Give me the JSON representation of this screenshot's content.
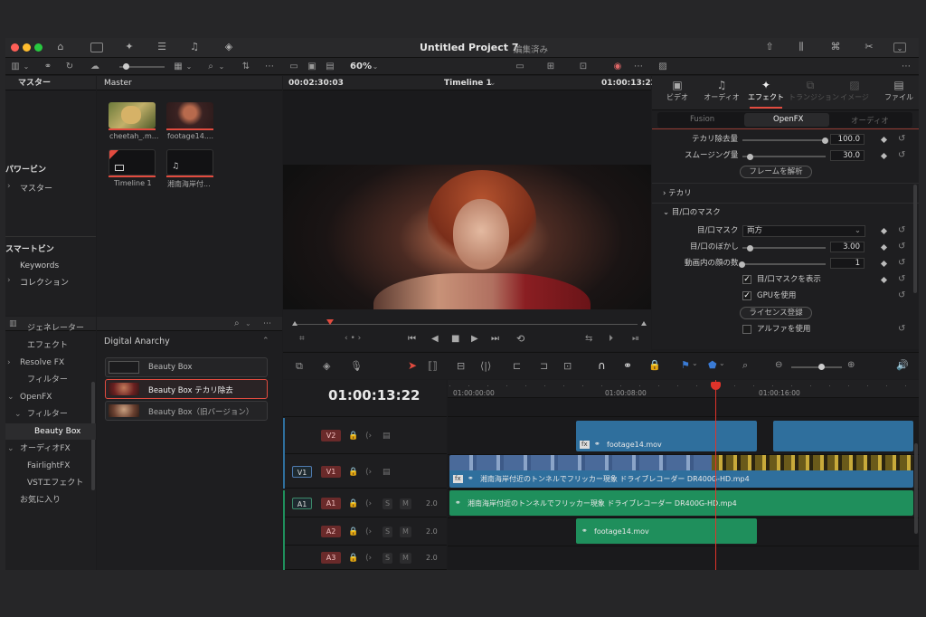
{
  "colors": {
    "accent": "#e24b3f",
    "video_clip": "#2f6f9d",
    "audio_clip": "#1f8f5c",
    "playhead": "#e0332a",
    "window_bg": "#1c1c1e"
  },
  "title": {
    "project": "Untitled Project 7",
    "status": "編集済み"
  },
  "toolbar": {
    "zoom": "60%"
  },
  "media_pool": {
    "sidebar_title": "マスター",
    "bin_title": "Master",
    "power_bins_title": "パワービン",
    "power_bins_items": [
      "マスター"
    ],
    "smart_bins_title": "スマートビン",
    "smart_bins_items": [
      "Keywords",
      "コレクション"
    ],
    "clips": [
      {
        "name": "cheetah_.m...",
        "icon": "video-thumb"
      },
      {
        "name": "footage14....",
        "icon": "video-thumb"
      },
      {
        "name": "Timeline 1",
        "icon": "timeline-icon"
      },
      {
        "name": "湘南海岸付...",
        "icon": "music-icon"
      }
    ]
  },
  "effects_tree": [
    {
      "label": "ジェネレーター",
      "indent": 1,
      "arrow": ""
    },
    {
      "label": "エフェクト",
      "indent": 1,
      "arrow": ""
    },
    {
      "label": "Resolve FX",
      "indent": 0,
      "arrow": "›"
    },
    {
      "label": "フィルター",
      "indent": 1,
      "arrow": ""
    },
    {
      "label": "OpenFX",
      "indent": 0,
      "arrow": "⌄"
    },
    {
      "label": "フィルター",
      "indent": 1,
      "arrow": "⌄"
    },
    {
      "label": "Beauty Box",
      "indent": 2,
      "arrow": ""
    },
    {
      "label": "オーディオFX",
      "indent": 0,
      "arrow": "⌄"
    },
    {
      "label": "FairlightFX",
      "indent": 1,
      "arrow": ""
    },
    {
      "label": "VSTエフェクト",
      "indent": 1,
      "arrow": ""
    },
    {
      "label": "お気に入り",
      "indent": 0,
      "arrow": ""
    }
  ],
  "effects_list": {
    "group": "Digital Anarchy",
    "items": [
      "Beauty Box",
      "Beauty Box テカリ除去",
      "Beauty Box（旧バージョン）"
    ]
  },
  "viewer": {
    "duration": "00:02:30:03",
    "timeline_name": "Timeline 1",
    "timecode": "01:00:13:22"
  },
  "inspector": {
    "top_tabs": [
      "ビデオ",
      "オーディオ",
      "エフェクト",
      "トランジション",
      "イメージ",
      "ファイル"
    ],
    "sub_tabs": [
      "Fusion",
      "OpenFX",
      "オーディオ"
    ],
    "rows": {
      "shine_removal_label": "テカリ除去量",
      "shine_removal_value": "100.0",
      "shine_removal_level": 1.0,
      "smoothing_label": "スムージング量",
      "smoothing_value": "30.0",
      "smoothing_level": 0.1,
      "analyze_frame": "フレームを解析",
      "section_shine": "テカリ",
      "section_eyemouth": "目/口のマスク",
      "mask_label": "目/口マスク",
      "mask_value": "両方",
      "blur_label": "目/口のぼかし",
      "blur_value": "3.00",
      "blur_level": 0.1,
      "faces_label": "動画内の顔の数",
      "faces_value": "1",
      "faces_level": 0.0,
      "show_mask": "目/口マスクを表示",
      "use_gpu": "GPUを使用",
      "license": "ライセンス登録",
      "use_alpha": "アルファを使用"
    }
  },
  "timeline": {
    "timecode": "01:00:13:22",
    "ruler": [
      "01:00:00:00",
      "01:00:08:00",
      "01:00:16:00"
    ],
    "tracks": [
      {
        "id": "V2",
        "src": ""
      },
      {
        "id": "V1",
        "src": "V1"
      },
      {
        "id": "A1",
        "src": "A1",
        "level": "2.0"
      },
      {
        "id": "A2",
        "src": "",
        "level": "2.0"
      },
      {
        "id": "A3",
        "src": "",
        "level": "2.0"
      }
    ],
    "clips": {
      "v2_clip": "footage14.mov",
      "v1_clip": "湘南海岸付近のトンネルでフリッカー現象 ドライブレコーダー DR400G-HD.mp4",
      "a1_clip": "湘南海岸付近のトンネルでフリッカー現象 ドライブレコーダー DR400G-HD.mp4",
      "a2_clip": "footage14.mov"
    }
  }
}
